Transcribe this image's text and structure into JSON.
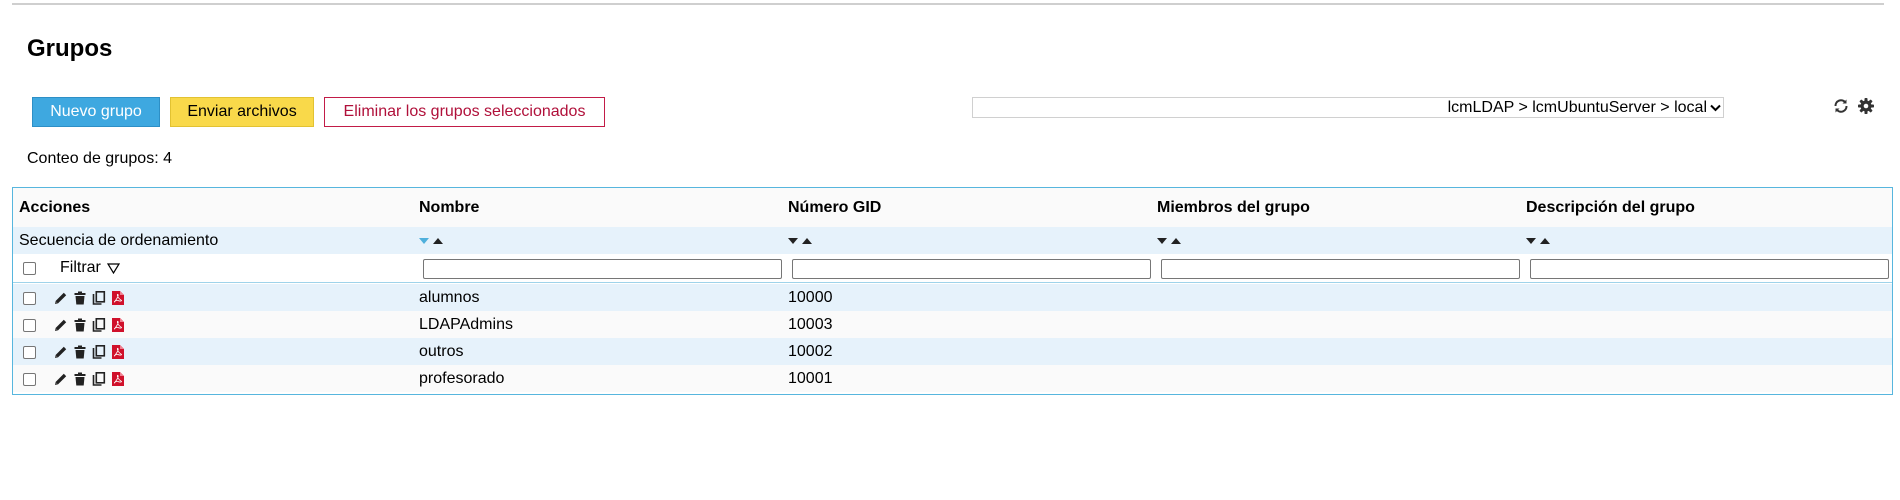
{
  "page": {
    "title": "Grupos"
  },
  "toolbar": {
    "new_group_label": "Nuevo grupo",
    "upload_label": "Enviar archivos",
    "delete_selected_label": "Eliminar los grupos seleccionados"
  },
  "server_select": {
    "value": "lcmLDAP > lcmUbuntuServer > local"
  },
  "count": {
    "label": "Conteo de grupos:",
    "value": "4"
  },
  "table": {
    "headers": [
      "Acciones",
      "Nombre",
      "Número GID",
      "Miembros del grupo",
      "Descripción del grupo"
    ],
    "sort_label": "Secuencia de ordenamiento",
    "filter_label": "Filtrar",
    "rows": [
      {
        "name": "alumnos",
        "gid": "10000",
        "members": "",
        "description": ""
      },
      {
        "name": "LDAPAdmins",
        "gid": "10003",
        "members": "",
        "description": ""
      },
      {
        "name": "outros",
        "gid": "10002",
        "members": "",
        "description": ""
      },
      {
        "name": "profesorado",
        "gid": "10001",
        "members": "",
        "description": ""
      }
    ]
  },
  "icons": {
    "row_actions": [
      "edit-icon",
      "delete-icon",
      "copy-icon",
      "pdf-icon"
    ],
    "toolbar": [
      "refresh-icon",
      "gear-icon"
    ],
    "filter": "filter-icon"
  },
  "colors": {
    "primary_button": "#3ea8e0",
    "upload_button": "#f9d94a",
    "danger_text": "#b0103a",
    "table_border": "#57b6de",
    "row_highlight": "#e6f2fb",
    "pdf_red": "#d0112b"
  }
}
